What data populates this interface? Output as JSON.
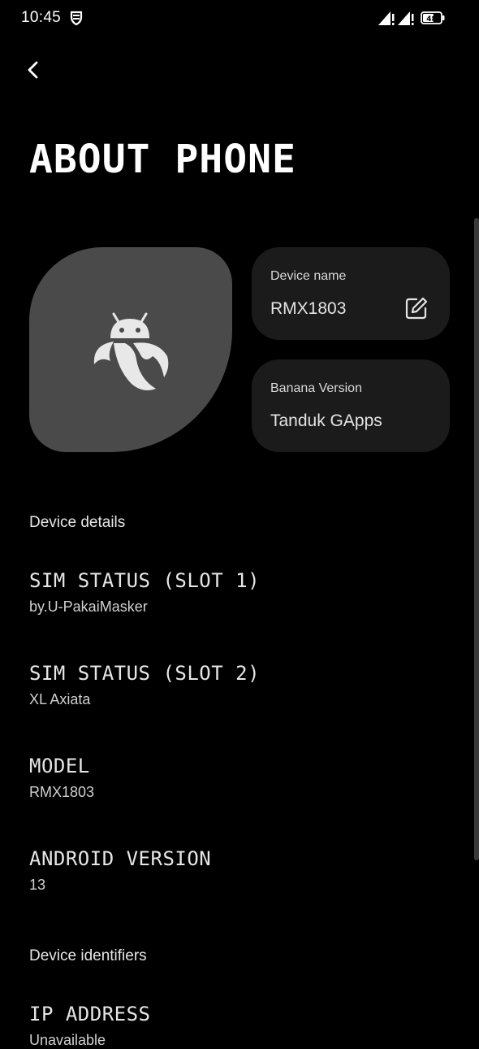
{
  "status_bar": {
    "time": "10:45",
    "battery_level": "48",
    "icons": [
      "shield-vpn-icon",
      "signal-sim1-icon",
      "signal-sim2-icon",
      "battery-icon"
    ]
  },
  "header": {
    "back_icon": "chevron-left-icon",
    "title": "ABOUT PHONE"
  },
  "hero": {
    "logo_icon": "banana-android-logo-icon"
  },
  "cards": {
    "device_name": {
      "label": "Device name",
      "value": "RMX1803",
      "icon": "edit-icon"
    },
    "banana_version": {
      "label": "Banana Version",
      "value": "Tanduk GApps"
    }
  },
  "sections": {
    "device_details": "Device details",
    "device_identifiers": "Device identifiers"
  },
  "items": [
    {
      "title": "SIM STATUS (SLOT 1)",
      "subtitle": "by.U-PakaiMasker"
    },
    {
      "title": "SIM STATUS (SLOT 2)",
      "subtitle": "XL Axiata"
    },
    {
      "title": "MODEL",
      "subtitle": "RMX1803"
    },
    {
      "title": "ANDROID VERSION",
      "subtitle": "13"
    },
    {
      "title": "IP ADDRESS",
      "subtitle": "Unavailable"
    }
  ],
  "colors": {
    "background": "#000000",
    "hero_bg": "#4a4a4a",
    "card_bg": "#1b1b1b",
    "text": "#e6e6e6"
  }
}
